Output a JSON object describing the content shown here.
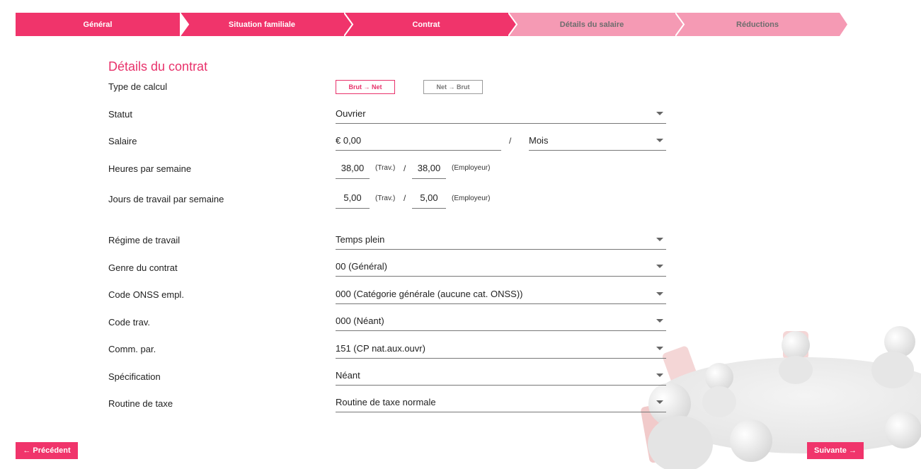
{
  "stepper": {
    "steps": [
      {
        "label": "Général",
        "state": "done"
      },
      {
        "label": "Situation familiale",
        "state": "done"
      },
      {
        "label": "Contrat",
        "state": "current"
      },
      {
        "label": "Détails du salaire",
        "state": "upcoming"
      },
      {
        "label": "Réductions",
        "state": "upcoming"
      }
    ],
    "colors": {
      "active": "#f0346b",
      "inactive": "#f59ab4"
    }
  },
  "form": {
    "title": "Détails du contrat",
    "calc_type": {
      "label": "Type de calcul",
      "option_gross_net": "Brut → Net",
      "option_net_gross": "Net → Brut",
      "selected": "Brut → Net"
    },
    "statut": {
      "label": "Statut",
      "value": "Ouvrier"
    },
    "salaire": {
      "label": "Salaire",
      "value": "€ 0,00",
      "separator": "/",
      "period": "Mois"
    },
    "heures": {
      "label": "Heures par semaine",
      "worker": "38,00",
      "worker_hint": "(Trav.)",
      "separator": "/",
      "employer": "38,00",
      "employer_hint": "(Employeur)"
    },
    "jours": {
      "label": "Jours de travail par semaine",
      "worker": "5,00",
      "worker_hint": "(Trav.)",
      "separator": "/",
      "employer": "5,00",
      "employer_hint": "(Employeur)"
    },
    "regime": {
      "label": "Régime de travail",
      "value": "Temps plein"
    },
    "genre": {
      "label": "Genre du contrat",
      "value": "00 (Général)"
    },
    "onss": {
      "label": "Code ONSS empl.",
      "value": "000 (Catégorie générale (aucune cat. ONSS))"
    },
    "code_trav": {
      "label": "Code trav.",
      "value": "000 (Néant)"
    },
    "comm_par": {
      "label": "Comm. par.",
      "value": "151 (CP nat.aux.ouvr)"
    },
    "specification": {
      "label": "Spécification",
      "value": "Néant"
    },
    "routine": {
      "label": "Routine de taxe",
      "value": "Routine de taxe normale"
    }
  },
  "nav": {
    "previous": "← Précédent",
    "next": "Suivante →"
  }
}
